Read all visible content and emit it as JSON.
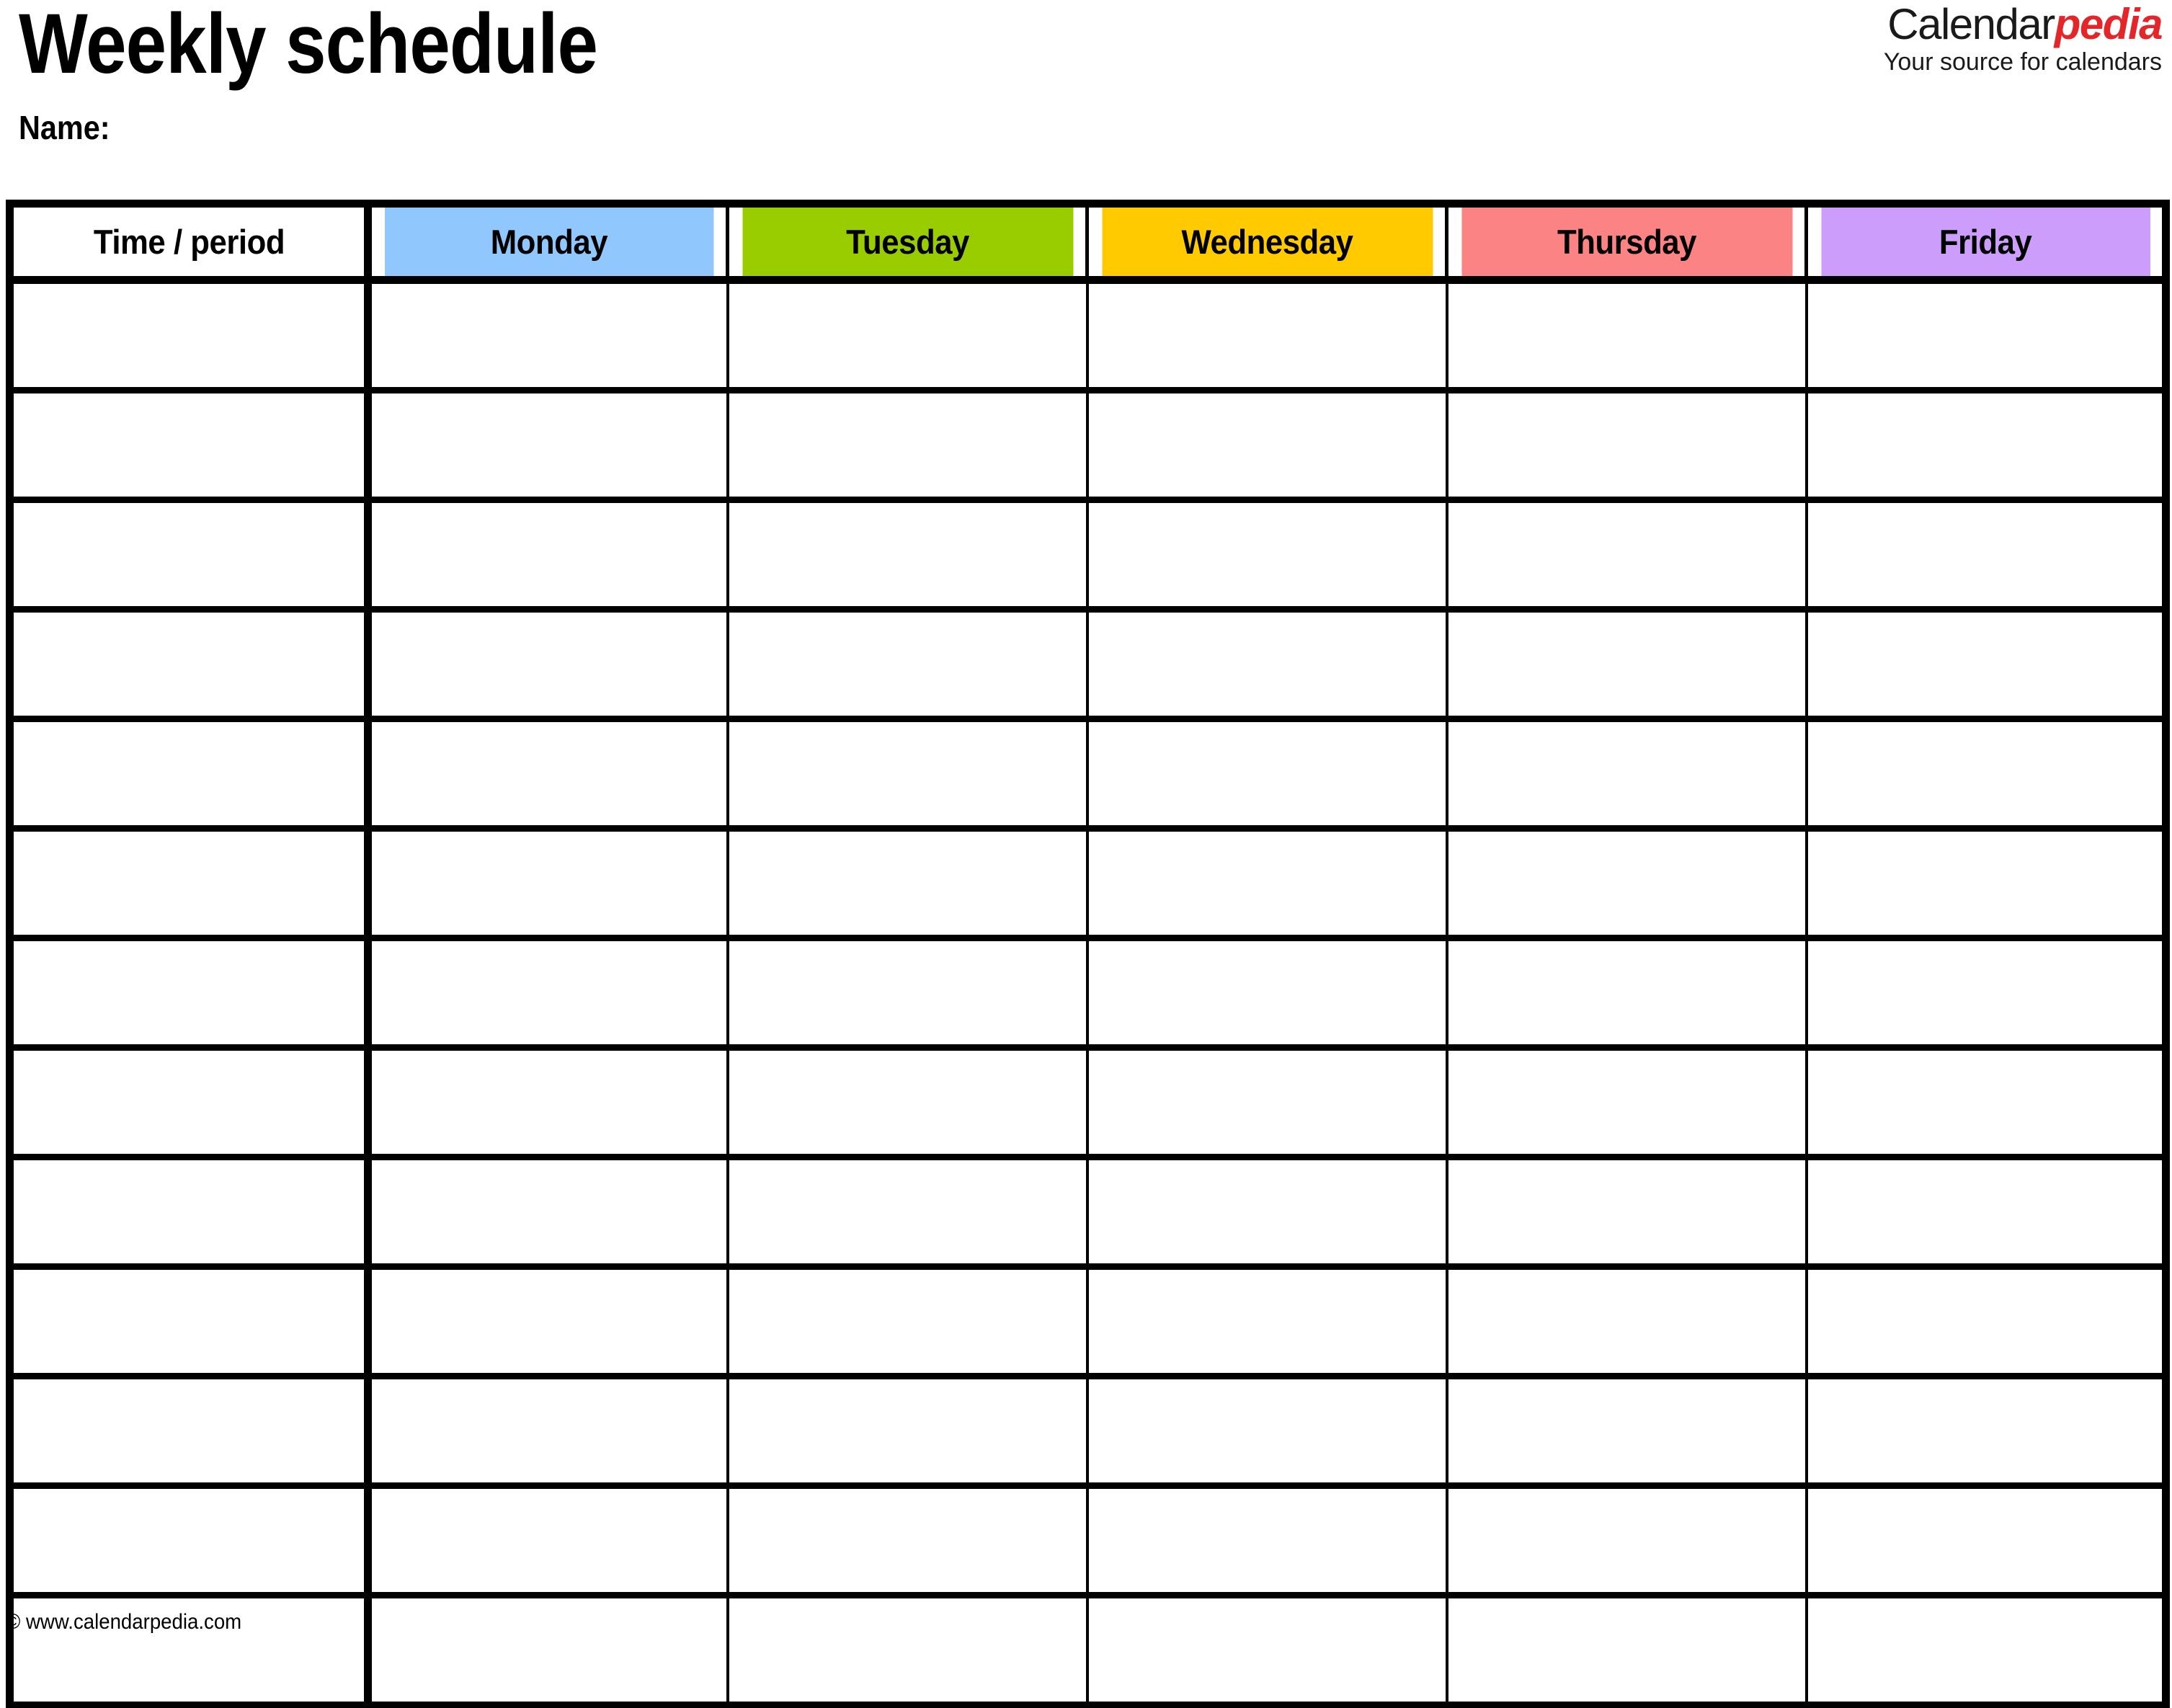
{
  "header": {
    "title": "Weekly schedule",
    "name_label": "Name:"
  },
  "brand": {
    "name_dark": "Calendar",
    "name_accent": "pedia",
    "tagline": "Your source for calendars",
    "accent_color": "#e3262a",
    "dark_color": "#1a1a1a"
  },
  "table": {
    "columns": [
      {
        "label": "Time / period",
        "color": "#ffffff",
        "type": "time"
      },
      {
        "label": "Monday",
        "color": "#90c8fd",
        "type": "day"
      },
      {
        "label": "Tuesday",
        "color": "#9acd00",
        "type": "day"
      },
      {
        "label": "Wednesday",
        "color": "#ffcb00",
        "type": "day"
      },
      {
        "label": "Thursday",
        "color": "#fc8383",
        "type": "day"
      },
      {
        "label": "Friday",
        "color": "#cc9dfa",
        "type": "day"
      }
    ],
    "row_count": 13,
    "rows": [
      {
        "time": "",
        "cells": [
          "",
          "",
          "",
          "",
          ""
        ]
      },
      {
        "time": "",
        "cells": [
          "",
          "",
          "",
          "",
          ""
        ]
      },
      {
        "time": "",
        "cells": [
          "",
          "",
          "",
          "",
          ""
        ]
      },
      {
        "time": "",
        "cells": [
          "",
          "",
          "",
          "",
          ""
        ]
      },
      {
        "time": "",
        "cells": [
          "",
          "",
          "",
          "",
          ""
        ]
      },
      {
        "time": "",
        "cells": [
          "",
          "",
          "",
          "",
          ""
        ]
      },
      {
        "time": "",
        "cells": [
          "",
          "",
          "",
          "",
          ""
        ]
      },
      {
        "time": "",
        "cells": [
          "",
          "",
          "",
          "",
          ""
        ]
      },
      {
        "time": "",
        "cells": [
          "",
          "",
          "",
          "",
          ""
        ]
      },
      {
        "time": "",
        "cells": [
          "",
          "",
          "",
          "",
          ""
        ]
      },
      {
        "time": "",
        "cells": [
          "",
          "",
          "",
          "",
          ""
        ]
      },
      {
        "time": "",
        "cells": [
          "",
          "",
          "",
          "",
          ""
        ]
      },
      {
        "time": "",
        "cells": [
          "",
          "",
          "",
          "",
          ""
        ]
      }
    ]
  },
  "footer": {
    "copyright": "© www.calendarpedia.com"
  }
}
